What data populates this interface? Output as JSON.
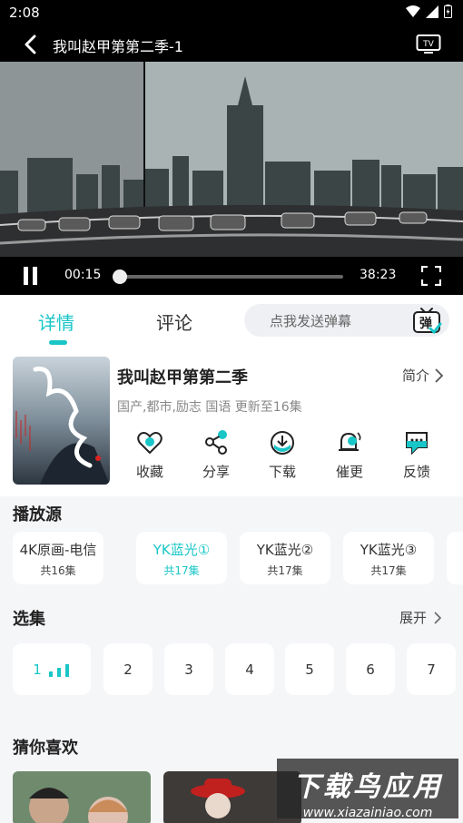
{
  "status": {
    "time": "2:08"
  },
  "header": {
    "title": "我叫赵甲第第二季-1",
    "back_icon": "back-arrow-icon",
    "cast_icon": "tv-cast-icon"
  },
  "player": {
    "current_time": "00:15",
    "total_time": "38:23",
    "progress": 0.0065
  },
  "tabs": {
    "detail": "详情",
    "comment": "评论",
    "danmu_placeholder": "点我发送弹幕",
    "danmu_icon_label": "弹"
  },
  "show": {
    "title": "我叫赵甲第第二季",
    "intro_label": "简介",
    "meta": "国产,都市,励志 国语 更新至16集",
    "actions": [
      {
        "label": "收藏",
        "icon": "heart-icon"
      },
      {
        "label": "分享",
        "icon": "share-icon"
      },
      {
        "label": "下载",
        "icon": "download-icon"
      },
      {
        "label": "催更",
        "icon": "bell-icon"
      },
      {
        "label": "反馈",
        "icon": "feedback-icon"
      }
    ]
  },
  "sources": {
    "title": "播放源",
    "items": [
      {
        "name": "4K原画-电信",
        "count": "共16集",
        "active": false
      },
      {
        "name": "YK蓝光①",
        "count": "共17集",
        "active": true
      },
      {
        "name": "YK蓝光②",
        "count": "共17集",
        "active": false
      },
      {
        "name": "YK蓝光③",
        "count": "共17集",
        "active": false
      }
    ]
  },
  "episodes": {
    "title": "选集",
    "expand_label": "展开",
    "items": [
      "1",
      "2",
      "3",
      "4",
      "5",
      "6",
      "7"
    ]
  },
  "recommend": {
    "title": "猜你喜欢"
  },
  "watermark": {
    "line1": "下载鸟应用",
    "line2": "www.xiazainiao.com"
  },
  "colors": {
    "accent": "#19c6c7"
  }
}
